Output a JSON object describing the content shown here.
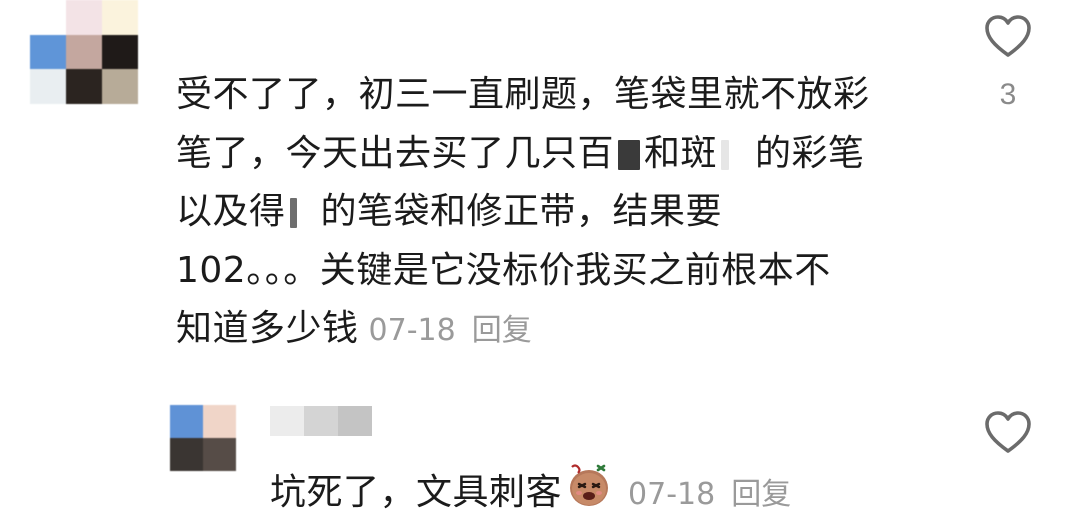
{
  "comment": {
    "lines": [
      "受不了了，初三一直刷题，笔袋里就不放彩",
      "笔了，今天出去买了几只百",
      "和斑",
      "的彩笔",
      "以及得",
      "的笔袋和修正带，结果要",
      "102。。。关键是它没标价我买之前根本不",
      "知道多少钱"
    ],
    "date": "07-18",
    "reply_label": "回复",
    "like_count": "3"
  },
  "reply": {
    "text": "坑死了，文具刺客",
    "emoji": "angry-potato-emoji",
    "date": "07-18",
    "reply_label": "回复"
  },
  "icons": {
    "like": "heart-outline-icon"
  },
  "colors": {
    "text": "#1b1b1b",
    "meta": "#9a9a9a",
    "background": "#ffffff"
  }
}
